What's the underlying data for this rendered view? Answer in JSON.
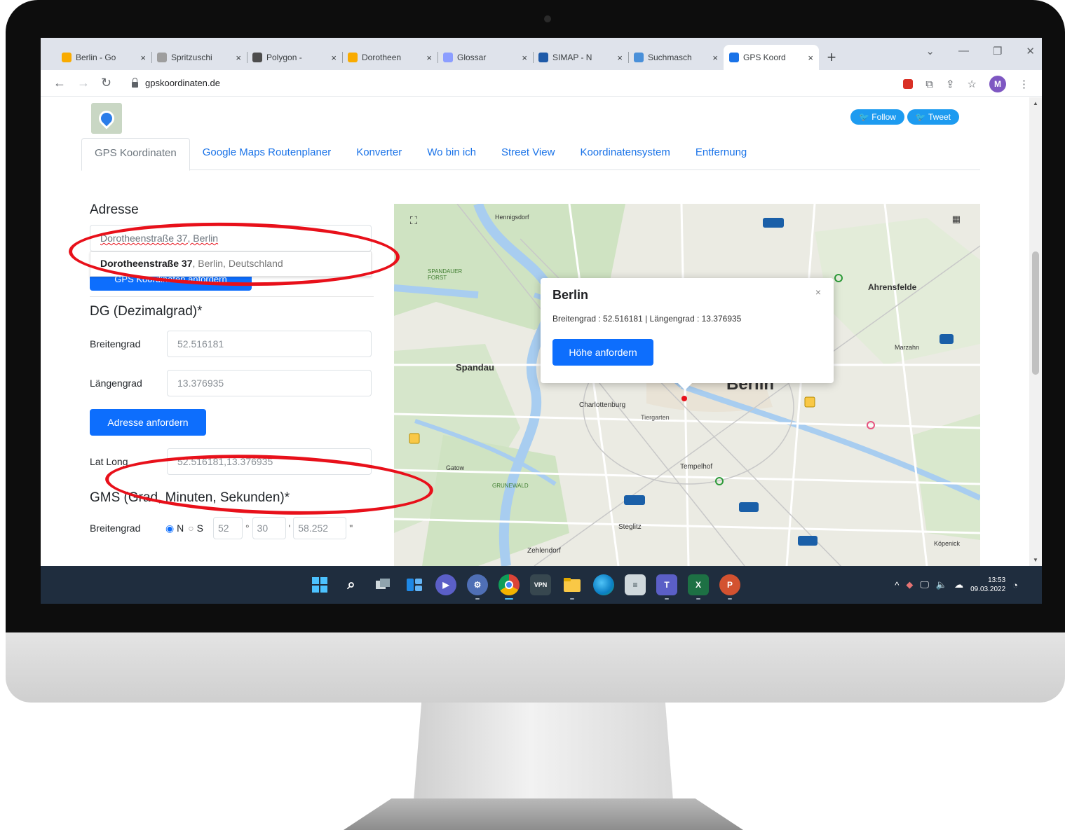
{
  "browser": {
    "tabs": [
      {
        "title": "Berlin - Go",
        "fav_color": "#f9ab00"
      },
      {
        "title": "Spritzuschi",
        "fav_color": "#9e9e9e"
      },
      {
        "title": "Polygon - ",
        "fav_color": "#4d4d4d"
      },
      {
        "title": "Dorotheen",
        "fav_color": "#f9ab00"
      },
      {
        "title": "Glossar",
        "fav_color": "#8c9eff"
      },
      {
        "title": "SIMAP - N",
        "fav_color": "#1e5aa8"
      },
      {
        "title": "Suchmasch",
        "fav_color": "#4a90d9"
      },
      {
        "title": "GPS Koord",
        "fav_color": "#1a73e8"
      }
    ],
    "active_tab_index": 7,
    "url": "gpskoordinaten.de",
    "profile_initial": "M"
  },
  "site": {
    "social": {
      "follow": "Follow",
      "tweet": "Tweet"
    },
    "nav_tabs": [
      "GPS Koordinaten",
      "Google Maps Routenplaner",
      "Konverter",
      "Wo bin ich",
      "Street View",
      "Koordinatensystem",
      "Entfernung"
    ],
    "address": {
      "heading": "Adresse",
      "value": "Dorotheenstraße 37, Berlin",
      "autocomplete_bold": "Dorotheenstraße 37",
      "autocomplete_rest": ", Berlin, Deutschland",
      "button": "GPS Koordinaten anfordern"
    },
    "dg": {
      "heading": "DG (Dezimalgrad)*",
      "lat_label": "Breitengrad",
      "lat_value": "52.516181",
      "lng_label": "Längengrad",
      "lng_value": "13.376935",
      "button": "Adresse anfordern",
      "latlong_label": "Lat Long",
      "latlong_value": "52.516181,13.376935"
    },
    "gms": {
      "heading": "GMS (Grad, Minuten, Sekunden)*",
      "lat_label": "Breitengrad",
      "radio_n": "N",
      "radio_s": "S",
      "deg": "52",
      "min": "30",
      "sec": "58.252"
    },
    "map": {
      "popup_title": "Berlin",
      "popup_coords": "Breitengrad : 52.516181 | Längengrad : 13.376935",
      "popup_button": "Höhe anfordern",
      "labels": {
        "berlin": "Berlin",
        "spandau": "Spandau",
        "charlottenburg": "Charlottenburg",
        "tiergarten": "Tiergarten",
        "ahrensfelde": "Ahrensfelde",
        "tempelhof": "Tempelhof",
        "steglitz": "Steglitz",
        "zehlendorf": "Zehlendorf",
        "gatow": "Gatow",
        "grunewald": "GRUNEWALD",
        "spandauer_forst": "SPANDAUER FORST",
        "hennigsdorf": "Hennigsdorf",
        "kopenick": "Köpenick",
        "marzahn": "Marzahn"
      },
      "shields": [
        "114",
        "100",
        "103",
        "113",
        "2",
        "5",
        "10"
      ]
    }
  },
  "taskbar": {
    "time": "13:53",
    "date": "09.03.2022"
  }
}
